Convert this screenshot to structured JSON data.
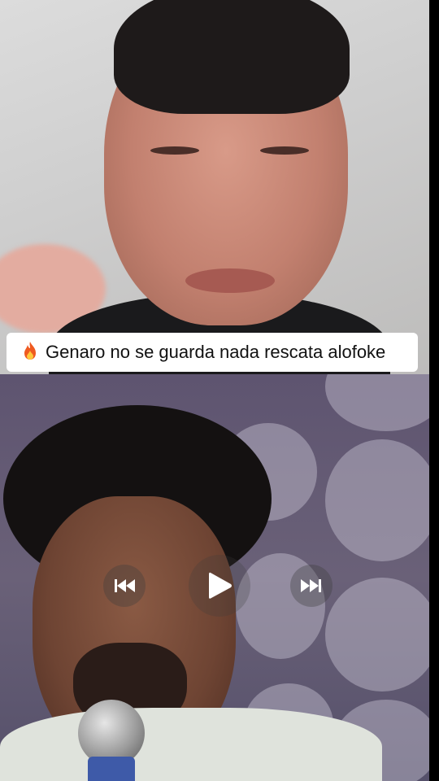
{
  "caption": {
    "icon": "fire-icon",
    "text": "Genaro no se guarda nada rescata alofoke"
  },
  "controls": {
    "previous": "previous-track-icon",
    "play": "play-icon",
    "next": "next-track-icon"
  },
  "colors": {
    "caption_background": "#ffffff",
    "fire": "#e8461e",
    "bottom_background": "#5e5470"
  }
}
